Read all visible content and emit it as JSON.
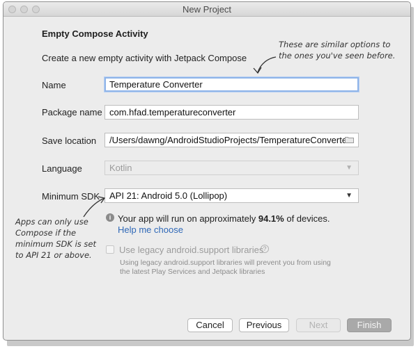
{
  "window": {
    "title": "New Project"
  },
  "page": {
    "heading": "Empty Compose Activity",
    "subtitle": "Create a new empty activity with Jetpack Compose"
  },
  "form": {
    "name": {
      "label": "Name",
      "value": "Temperature Converter"
    },
    "package": {
      "label": "Package name",
      "value": "com.hfad.temperatureconverter"
    },
    "save_location": {
      "label": "Save location",
      "value": "/Users/dawng/AndroidStudioProjects/TemperatureConverter",
      "icon": "folder-icon"
    },
    "language": {
      "label": "Language",
      "value": "Kotlin"
    },
    "min_sdk": {
      "label": "Minimum SDK",
      "value": "API 21: Android 5.0 (Lollipop)"
    }
  },
  "info": {
    "prefix": "Your app will run on approximately ",
    "percent": "94.1%",
    "suffix": " of devices.",
    "help_link": "Help me choose"
  },
  "legacy": {
    "label": "Use legacy android.support libraries",
    "checked": false,
    "note": "Using legacy android.support libraries will prevent you from using the latest Play Services and Jetpack libraries"
  },
  "buttons": {
    "cancel": "Cancel",
    "previous": "Previous",
    "next": "Next",
    "finish": "Finish"
  },
  "annotations": {
    "top_line1": "These are similar options to",
    "top_line2": "the ones you've seen before.",
    "left_line1": "Apps can only use",
    "left_line2": "Compose if the",
    "left_line3": "minimum SDK is set",
    "left_line4": "to API 21 or above."
  }
}
